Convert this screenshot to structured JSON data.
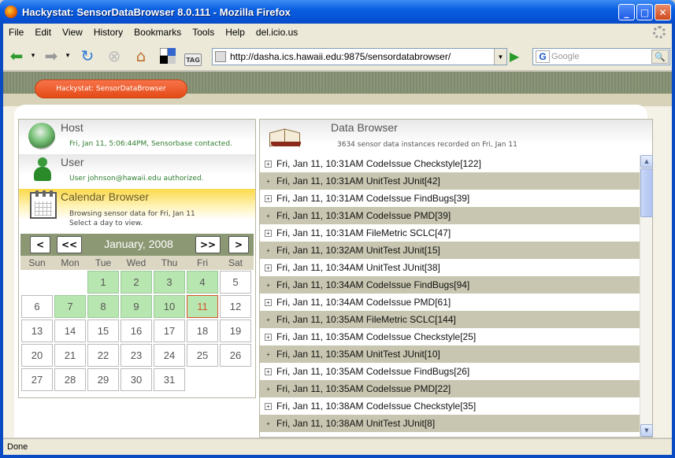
{
  "window": {
    "title": "Hackystat: SensorDataBrowser 8.0.111 - Mozilla Firefox",
    "min_label": "_",
    "max_label": "□",
    "close_label": "✕"
  },
  "menu": [
    "File",
    "Edit",
    "View",
    "History",
    "Bookmarks",
    "Tools",
    "Help",
    "del.icio.us"
  ],
  "toolbar": {
    "url": "http://dasha.ics.hawaii.edu:9875/sensordatabrowser/",
    "search_placeholder": "Google",
    "tag_label": "TAG"
  },
  "page": {
    "app_button": "Hackystat: SensorDataBrowser",
    "host": {
      "title": "Host",
      "status": "Fri, Jan 11, 5:06:44PM, Sensorbase contacted."
    },
    "user": {
      "title": "User",
      "status": "User johnson@hawaii.edu authorized."
    },
    "calendar": {
      "title": "Calendar Browser",
      "line1": "Browsing sensor data for Fri, Jan 11",
      "line2": "Select a day to view.",
      "prev_month": "<",
      "prev_year": "<<",
      "month_label": "January, 2008",
      "next_year": ">>",
      "next_month": ">",
      "day_names": [
        "Sun",
        "Mon",
        "Tue",
        "Wed",
        "Thu",
        "Fri",
        "Sat"
      ],
      "days": [
        "1",
        "2",
        "3",
        "4",
        "5",
        "6",
        "7",
        "8",
        "9",
        "10",
        "11",
        "12",
        "13",
        "14",
        "15",
        "16",
        "17",
        "18",
        "19",
        "20",
        "21",
        "22",
        "23",
        "24",
        "25",
        "26",
        "27",
        "28",
        "29",
        "30",
        "31"
      ],
      "days_with_data": [
        1,
        2,
        3,
        4,
        7,
        8,
        9,
        10,
        11
      ],
      "selected_day": 11,
      "first_weekday": 2
    },
    "data_browser": {
      "title": "Data Browser",
      "summary": "3634 sensor data instances recorded on Fri, Jan 11",
      "rows": [
        "Fri, Jan 11, 10:31AM CodeIssue Checkstyle[122]",
        "Fri, Jan 11, 10:31AM UnitTest JUnit[42]",
        "Fri, Jan 11, 10:31AM CodeIssue FindBugs[39]",
        "Fri, Jan 11, 10:31AM CodeIssue PMD[39]",
        "Fri, Jan 11, 10:31AM FileMetric SCLC[47]",
        "Fri, Jan 11, 10:32AM UnitTest JUnit[15]",
        "Fri, Jan 11, 10:34AM UnitTest JUnit[38]",
        "Fri, Jan 11, 10:34AM CodeIssue FindBugs[94]",
        "Fri, Jan 11, 10:34AM CodeIssue PMD[61]",
        "Fri, Jan 11, 10:35AM FileMetric SCLC[144]",
        "Fri, Jan 11, 10:35AM CodeIssue Checkstyle[25]",
        "Fri, Jan 11, 10:35AM UnitTest JUnit[10]",
        "Fri, Jan 11, 10:35AM CodeIssue FindBugs[26]",
        "Fri, Jan 11, 10:35AM CodeIssue PMD[22]",
        "Fri, Jan 11, 10:38AM CodeIssue Checkstyle[35]",
        "Fri, Jan 11, 10:38AM UnitTest JUnit[8]"
      ]
    }
  },
  "status": "Done",
  "colors": {
    "accent": "#e44a16",
    "has_data": "#b8e6b0",
    "alt_row": "#c8c6b0",
    "olive": "#8c9873"
  }
}
